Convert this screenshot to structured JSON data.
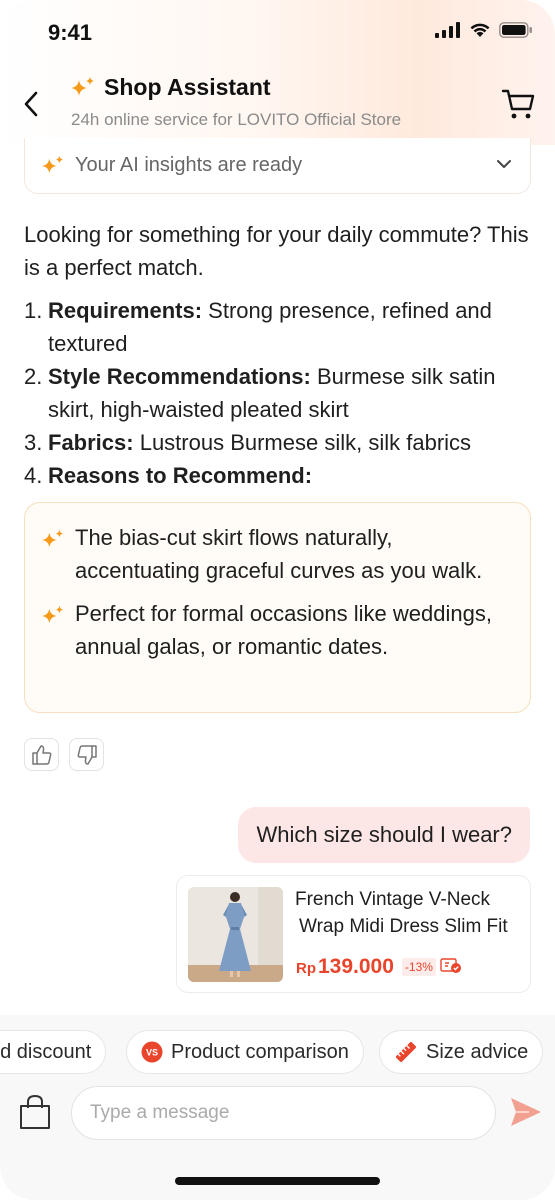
{
  "status_bar": {
    "time": "9:41"
  },
  "header": {
    "title": "Shop Assistant",
    "subtitle": "24h online service for LOVITO Official Store"
  },
  "insights": {
    "label": "Your AI insights are ready"
  },
  "assistant_message": {
    "intro": "Looking for something for your daily commute? This is a perfect match.",
    "items": [
      {
        "num": "1.",
        "label": "Requirements:",
        "text": " Strong presence, refined and textured"
      },
      {
        "num": "2.",
        "label": "Style Recommendations:",
        "text": " Burmese silk satin skirt, high-waisted pleated skirt"
      },
      {
        "num": "3.",
        "label": "Fabrics:",
        "text": " Lustrous Burmese silk, silk fabrics"
      },
      {
        "num": "4.",
        "label": "Reasons to Recommend:",
        "text": ""
      }
    ],
    "reasons": [
      "The bias-cut skirt flows naturally, accentuating graceful curves as you walk.",
      "Perfect for formal occasions like weddings, annual galas, or romantic dates."
    ]
  },
  "user_message": "Which size should I wear?",
  "product": {
    "name_line1": "French Vintage V-Neck",
    "name_line2": "Wrap Midi Dress Slim Fit",
    "currency": "Rp",
    "price": "139.000",
    "discount": "-13%"
  },
  "chips": [
    {
      "label": "nd discount",
      "icon": "discount-icon"
    },
    {
      "label": "Product comparison",
      "icon": "vs-icon"
    },
    {
      "label": "Size advice",
      "icon": "ruler-icon"
    }
  ],
  "composer": {
    "placeholder": "Type a message"
  },
  "colors": {
    "accent": "#e8452c",
    "sparkle": "#f59a1b",
    "user_bubble": "#fde7e6",
    "reasons_bg": "#fffbf6"
  }
}
